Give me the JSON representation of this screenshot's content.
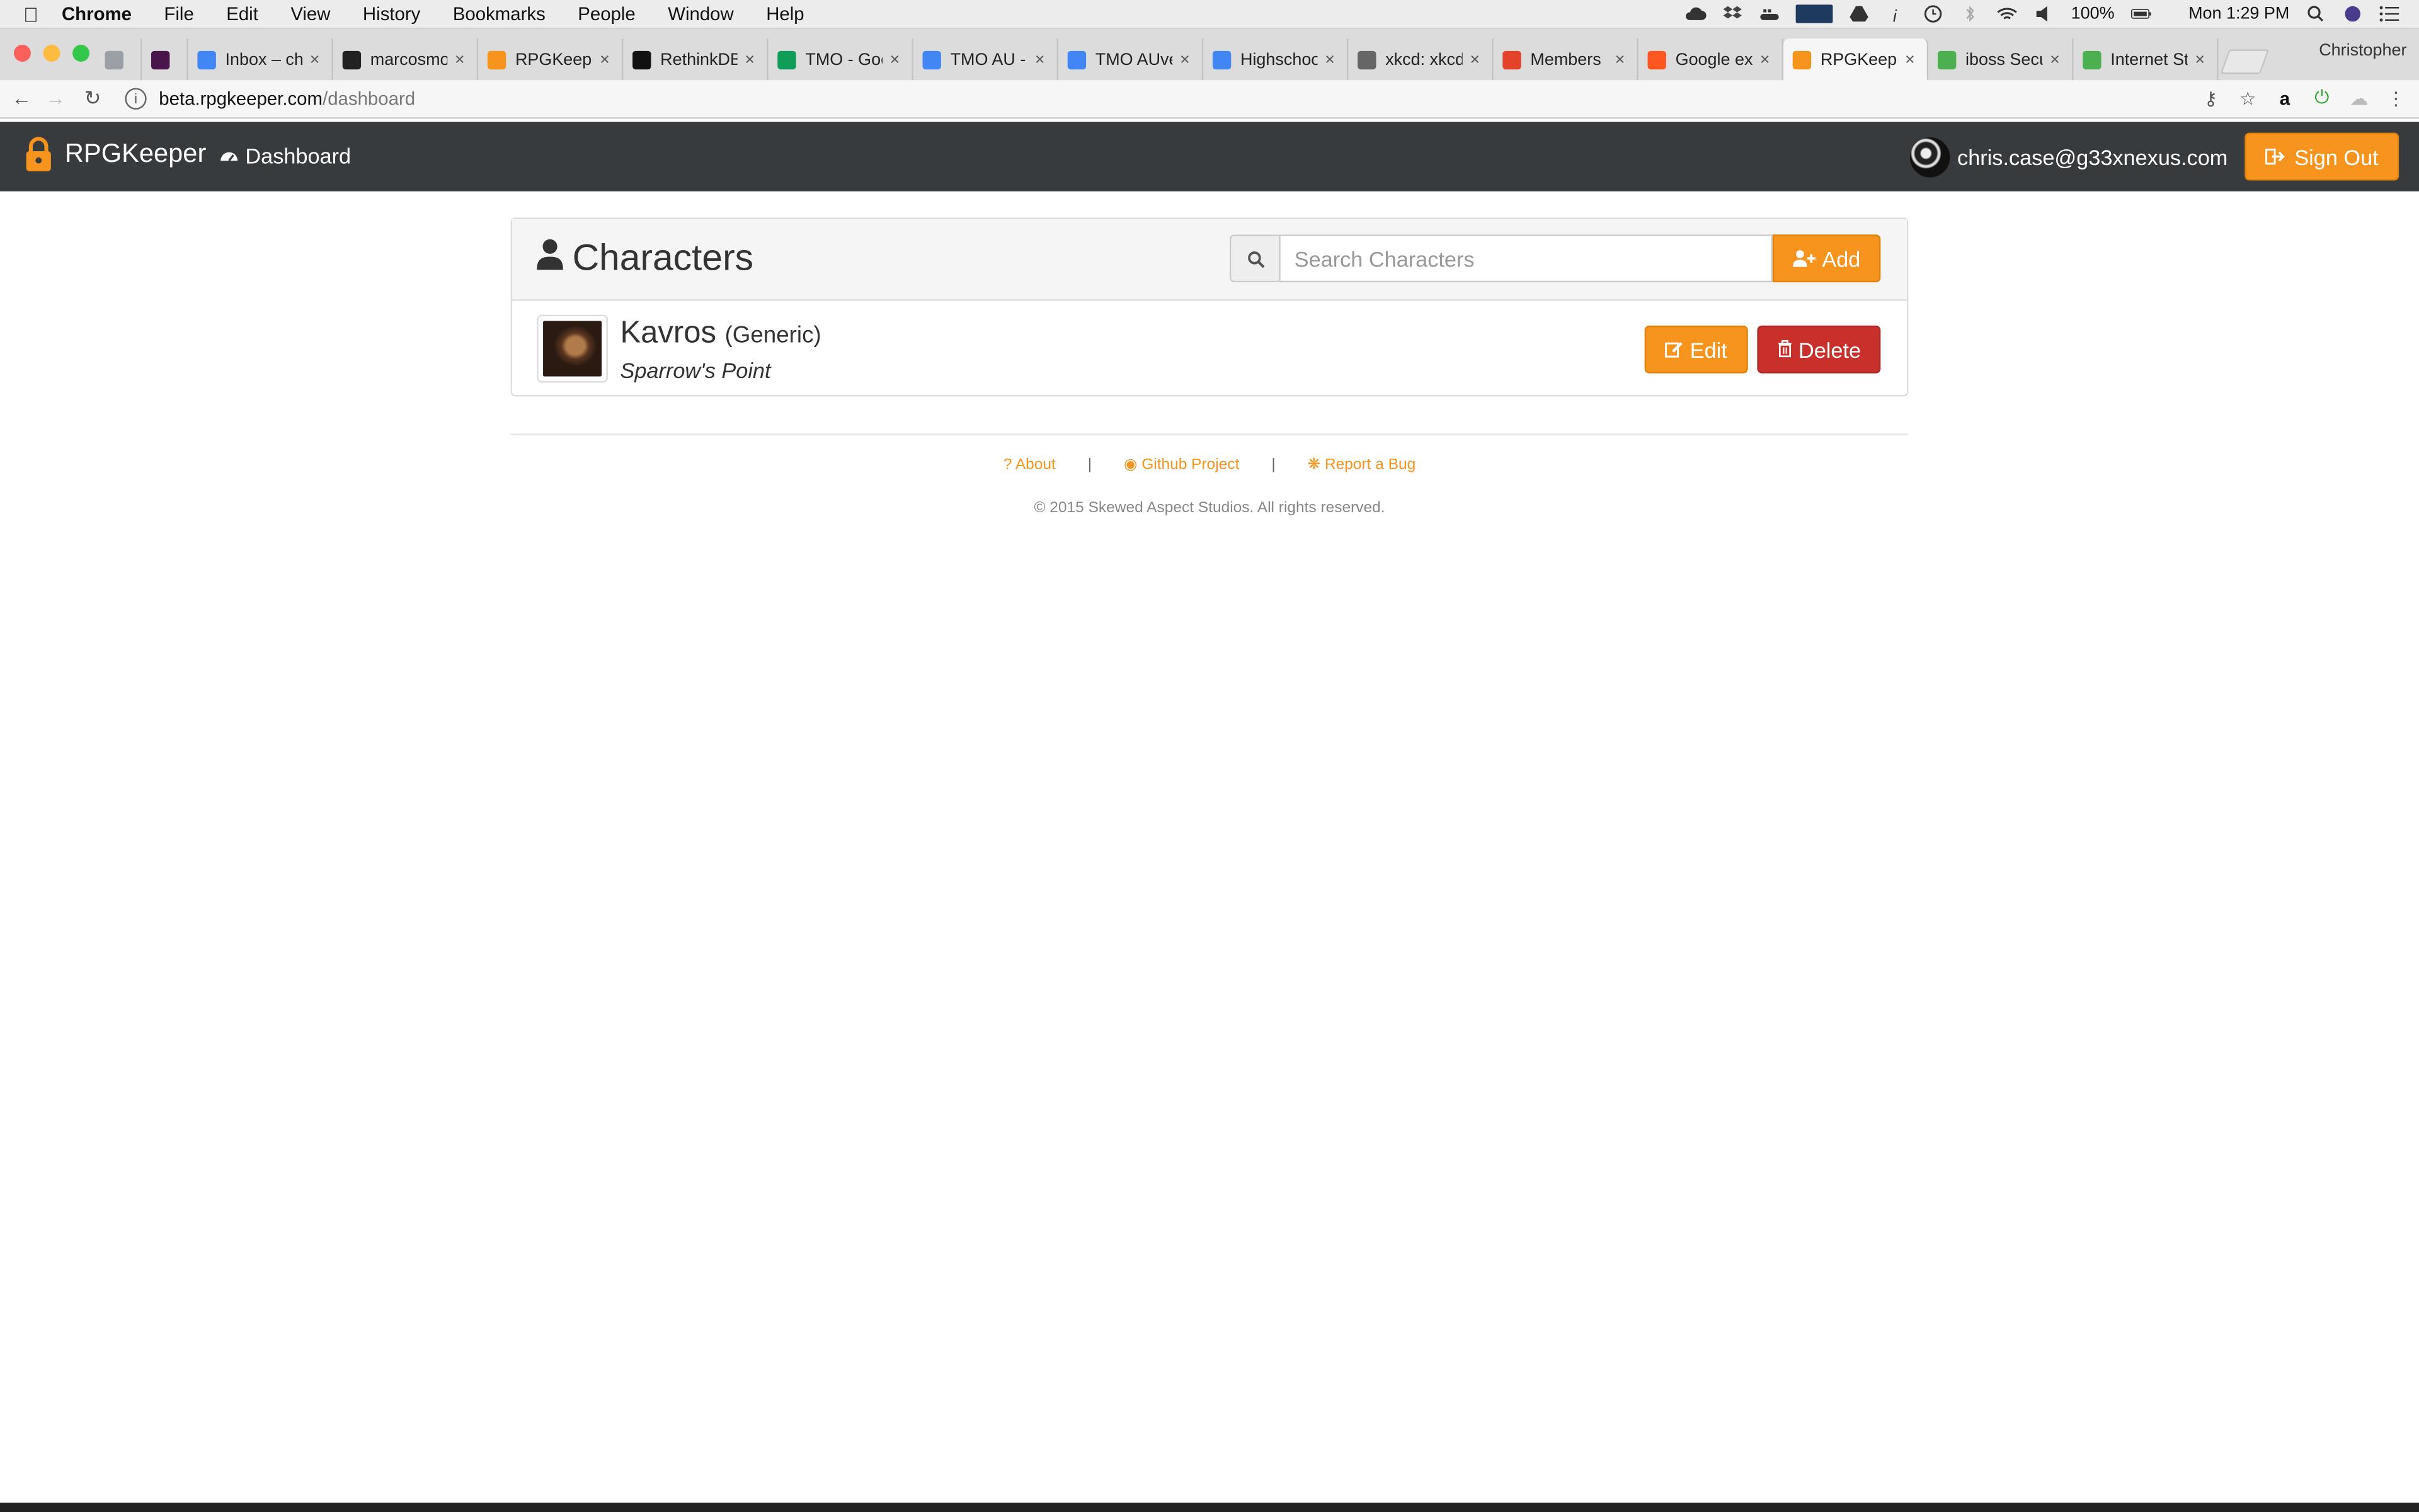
{
  "menubar": {
    "app": "Chrome",
    "items": [
      "File",
      "Edit",
      "View",
      "History",
      "Bookmarks",
      "People",
      "Window",
      "Help"
    ],
    "battery": "100%",
    "clock": "Mon 1:29 PM"
  },
  "tabs": [
    {
      "title": "",
      "fav_color": "#9aa0a6",
      "small": true
    },
    {
      "title": "",
      "fav_color": "#4a154b",
      "small": true
    },
    {
      "title": "Inbox – chr",
      "fav_color": "#4285f4"
    },
    {
      "title": "marcosmo",
      "fav_color": "#222222"
    },
    {
      "title": "RPGKeeper",
      "fav_color": "#f7941d"
    },
    {
      "title": "RethinkDB",
      "fav_color": "#111111"
    },
    {
      "title": "TMO - Goo",
      "fav_color": "#0f9d58"
    },
    {
      "title": "TMO AU - ",
      "fav_color": "#4285f4"
    },
    {
      "title": "TMO AUve",
      "fav_color": "#4285f4"
    },
    {
      "title": "Highschoo",
      "fav_color": "#4285f4"
    },
    {
      "title": "xkcd: xkcd",
      "fav_color": "#666666"
    },
    {
      "title": "Members",
      "fav_color": "#e24329"
    },
    {
      "title": "Google exp",
      "fav_color": "#ff5722"
    },
    {
      "title": "RPGKeeper",
      "fav_color": "#f7941d",
      "active": true
    },
    {
      "title": "iboss Secu",
      "fav_color": "#4caf50"
    },
    {
      "title": "Internet St",
      "fav_color": "#4caf50"
    }
  ],
  "browser": {
    "profile": "Christopher",
    "url_host": "beta.rpgkeeper.com",
    "url_path": "/dashboard"
  },
  "navbar": {
    "brand": "RPGKeeper",
    "dashboard": "Dashboard",
    "user_email": "chris.case@g33xnexus.com",
    "signout": "Sign Out"
  },
  "characters": {
    "title": "Characters",
    "search_placeholder": "Search Characters",
    "add_label": "Add",
    "list": [
      {
        "name": "Kavros",
        "system": "(Generic)",
        "campaign": "Sparrow's Point",
        "edit": "Edit",
        "delete": "Delete"
      }
    ]
  },
  "footer": {
    "about": "About",
    "github": "Github Project",
    "bug": "Report a Bug",
    "sep": "|",
    "copyright": "© 2015 Skewed Aspect Studios. All rights reserved."
  },
  "colors": {
    "accent": "#f7941d",
    "danger": "#c9302c",
    "navbar": "#383b3d"
  }
}
